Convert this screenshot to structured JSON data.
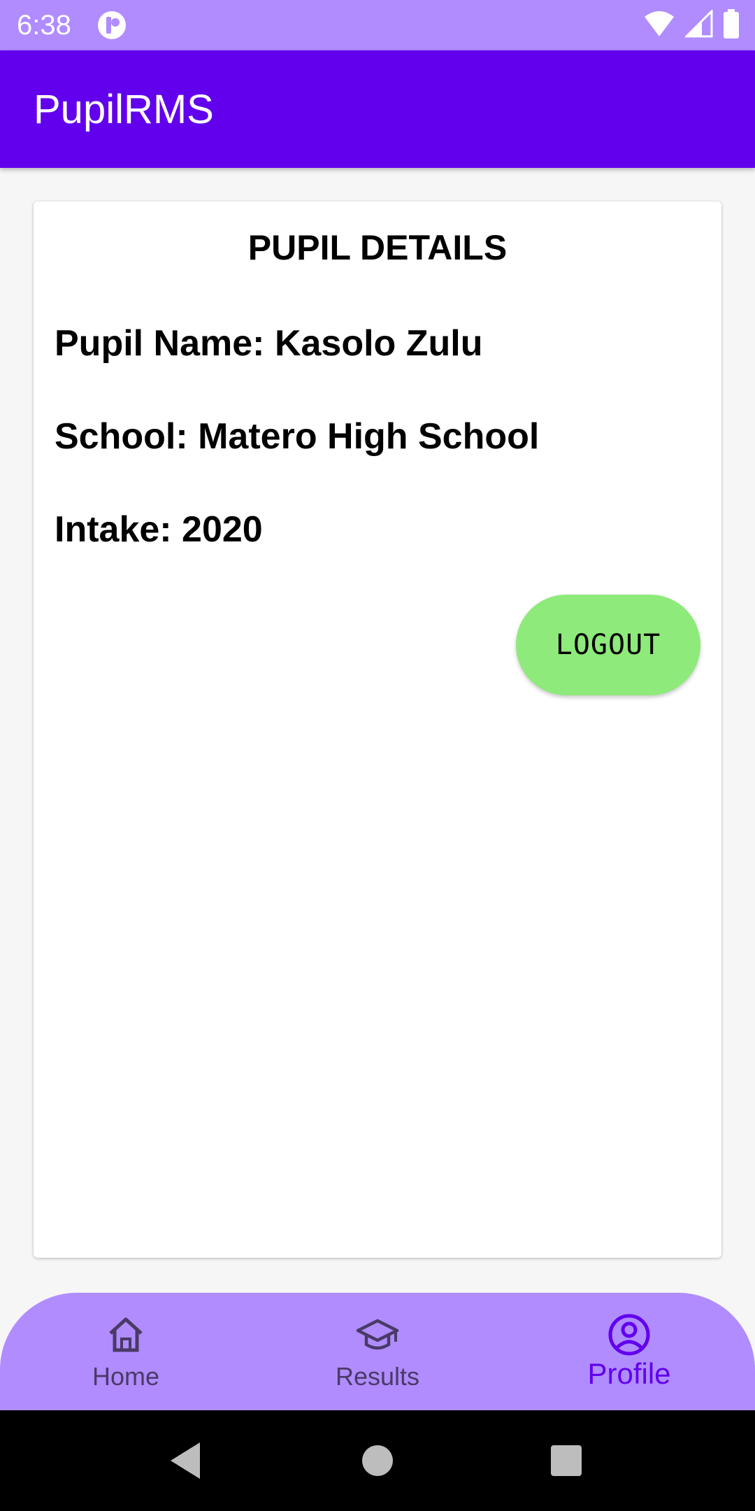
{
  "status_bar": {
    "time": "6:38"
  },
  "app_bar": {
    "title": "PupilRMS"
  },
  "card": {
    "title": "PUPIL DETAILS",
    "pupil_name": "Pupil Name: Kasolo Zulu",
    "school": "School: Matero High School",
    "intake": "Intake: 2020",
    "logout_label": "LOGOUT"
  },
  "bottom_nav": {
    "items": [
      {
        "label": "Home",
        "icon": "home-icon"
      },
      {
        "label": "Results",
        "icon": "graduation-cap-icon"
      },
      {
        "label": "Profile",
        "icon": "account-circle-icon"
      }
    ],
    "active": "Profile"
  },
  "colors": {
    "status_bar": "#b08cff",
    "app_bar": "#6200ee",
    "logout_button": "#8eea7a",
    "bottom_nav": "#b08cff",
    "active_nav": "#6200ee"
  }
}
